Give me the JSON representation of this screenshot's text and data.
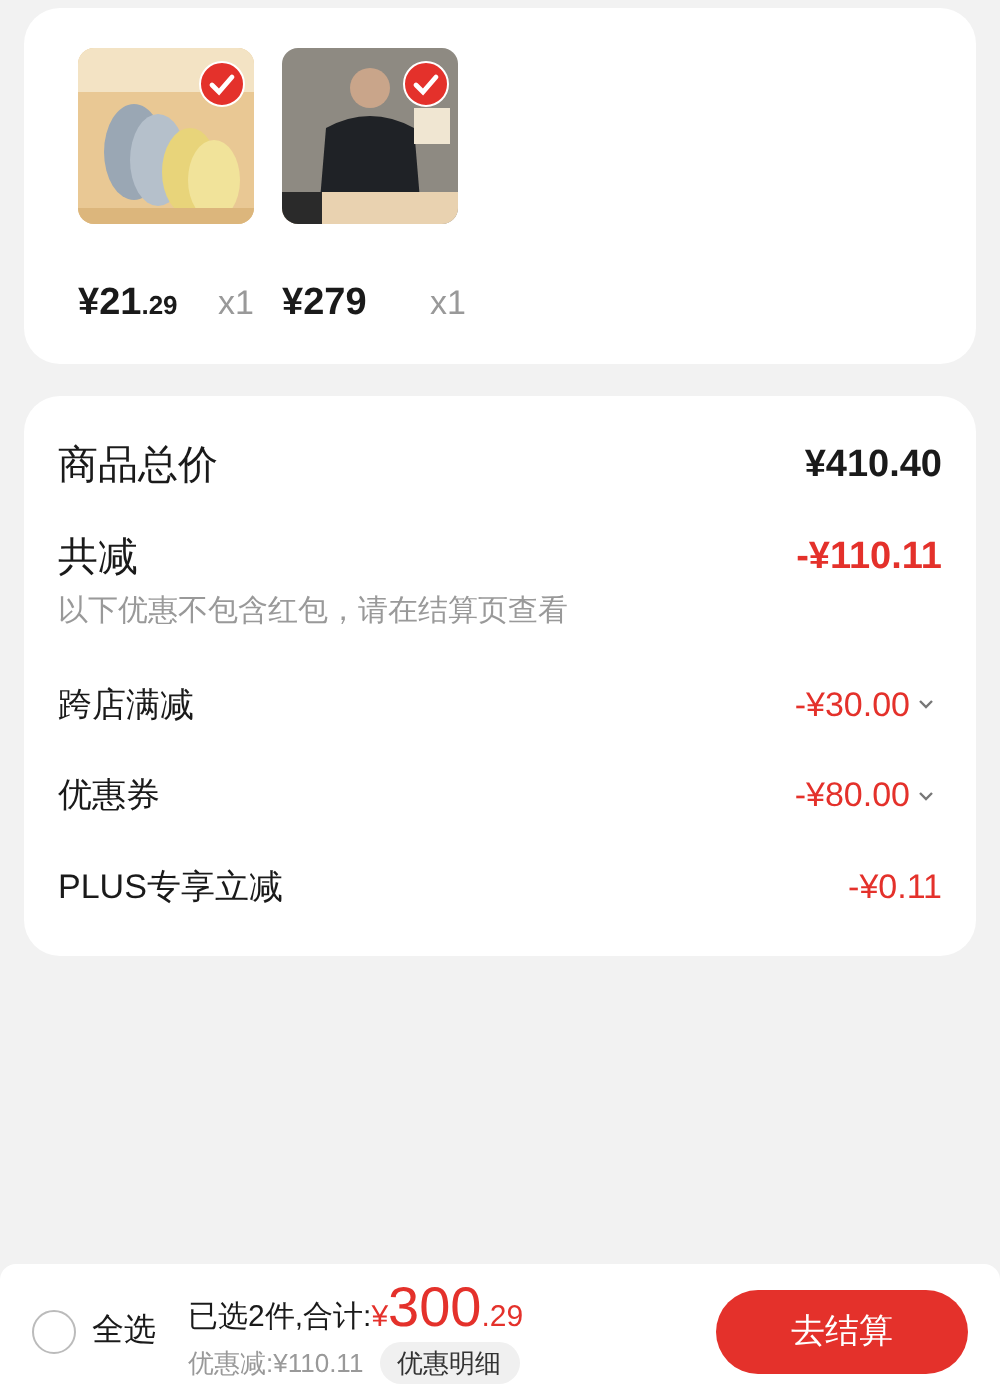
{
  "products": [
    {
      "kind": "picture",
      "selected": true,
      "price": "¥21",
      "price_cents": ".29",
      "quantity": "x1"
    },
    {
      "kind": "picture",
      "selected": true,
      "price": "¥279",
      "quantity": "x1"
    }
  ],
  "summary": {
    "total_label": "商品总价",
    "total_value": "¥410.40",
    "discount_label": "共减",
    "discount_value": "-¥110.11",
    "note": "以下优惠不包含红包，请在结算页查看",
    "items": [
      {
        "label": "跨店满减",
        "value": "-¥30.00",
        "expandable": true
      },
      {
        "label": "优惠券",
        "value": "-¥80.00",
        "expandable": true
      },
      {
        "label": "PLUS专享立减",
        "value": "-¥0.11",
        "expandable": false
      }
    ]
  },
  "footer": {
    "select_all": {
      "label": "全选",
      "checked": false
    },
    "selected_text": "已选2件,合计:",
    "currency": "¥",
    "total_main": "300",
    "total_cents": ".29",
    "saved": "优惠减:¥110.11",
    "detail_button": "优惠明细",
    "checkout_button": "去结算"
  }
}
